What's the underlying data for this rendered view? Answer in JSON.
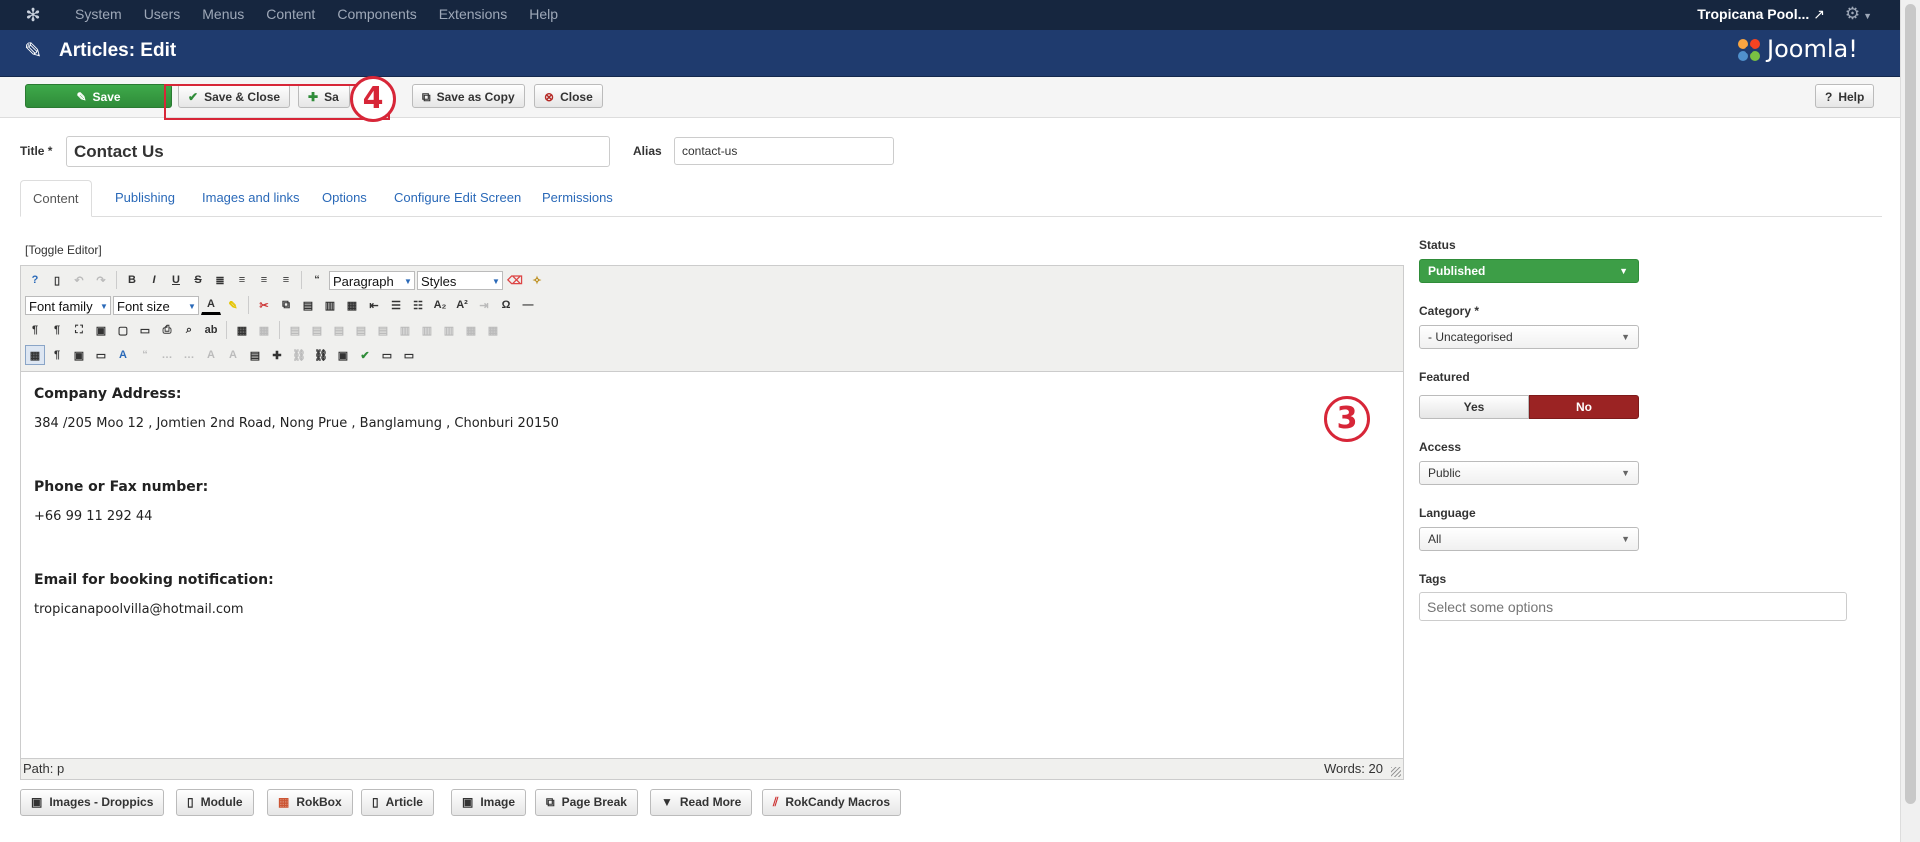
{
  "topbar": {
    "menu": [
      "System",
      "Users",
      "Menus",
      "Content",
      "Components",
      "Extensions",
      "Help"
    ],
    "site_name": "Tropicana Pool...",
    "icons": {
      "logo": "joomla-icon",
      "external": "external-link-icon",
      "settings": "gear-icon"
    }
  },
  "header": {
    "title": "Articles: Edit",
    "brand": "Joomla!"
  },
  "toolbar": {
    "save": "Save",
    "save_close": "Save & Close",
    "save_new": "Sa",
    "save_copy": "Save as Copy",
    "close": "Close",
    "help": "Help"
  },
  "annotations": {
    "toolbar_badge": "4",
    "editor_badge": "3",
    "color": "#d72638"
  },
  "form": {
    "title_label": "Title *",
    "title_value": "Contact Us",
    "alias_label": "Alias",
    "alias_value": "contact-us"
  },
  "tabs": [
    "Content",
    "Publishing",
    "Images and links",
    "Options",
    "Configure Edit Screen",
    "Permissions"
  ],
  "editor": {
    "toggle": "[Toggle Editor]",
    "format_select": "Paragraph",
    "styles_select": "Styles",
    "font_family": "Font family",
    "font_size": "Font size",
    "content": {
      "address_heading": "Company Address:",
      "address": "384 /205 Moo 12 , Jomtien 2nd Road, Nong Prue , Banglamung , Chonburi 20150",
      "phone_heading": "Phone or Fax number:",
      "phone": "+66 99 11 292 44",
      "email_heading": "Email for booking notification:",
      "email": "tropicanapoolvilla@hotmail.com"
    },
    "path": "Path: p",
    "words": "Words: 20"
  },
  "sidebar": {
    "status_label": "Status",
    "status_value": "Published",
    "category_label": "Category *",
    "category_value": "- Uncategorised",
    "featured_label": "Featured",
    "featured_yes": "Yes",
    "featured_no": "No",
    "access_label": "Access",
    "access_value": "Public",
    "language_label": "Language",
    "language_value": "All",
    "tags_label": "Tags",
    "tags_placeholder": "Select some options"
  },
  "editor_buttons": [
    "Images - Droppics",
    "Module",
    "RokBox",
    "Article",
    "Image",
    "Page Break",
    "Read More",
    "RokCandy Macros"
  ],
  "colors": {
    "navbar": "#16263f",
    "header": "#1f3b6e",
    "green": "#3d9e47",
    "red": "#9b2323",
    "link": "#2a69b8"
  }
}
